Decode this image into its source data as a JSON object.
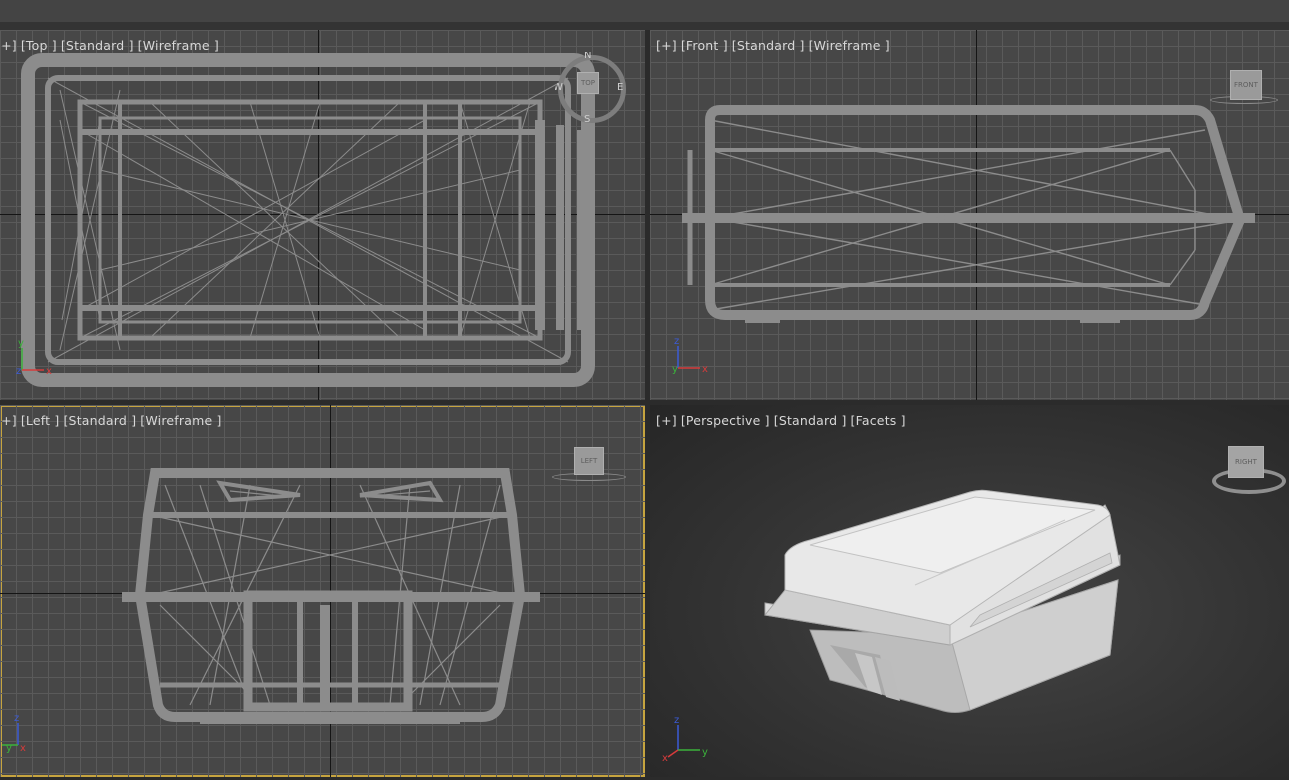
{
  "viewports": {
    "top": {
      "plus": "[+]",
      "view": "[Top ]",
      "shading": "[Standard ]",
      "mode": "[Wireframe ]"
    },
    "front": {
      "plus": "[+]",
      "view": "[Front ]",
      "shading": "[Standard ]",
      "mode": "[Wireframe ]"
    },
    "left": {
      "plus": "[+]",
      "view": "[Left ]",
      "shading": "[Standard ]",
      "mode": "[Wireframe ]"
    },
    "perspective": {
      "plus": "[+]",
      "view": "[Perspective ]",
      "shading": "[Standard ]",
      "mode": "[Facets ]"
    }
  },
  "viewcube": {
    "top_face": "TOP",
    "front_face": "FRONT",
    "left_face": "LEFT",
    "persp_face": "RIGHT",
    "compass": {
      "n": "N",
      "s": "S",
      "e": "E",
      "w": "W"
    }
  },
  "axes": {
    "x": "x",
    "y": "y",
    "z": "z"
  },
  "colors": {
    "viewport_bg": "#474747",
    "grid": "#5a5a5a",
    "wire": "#8c8c8c",
    "active_border": "#c6a43f",
    "axis_x": "#d63b3b",
    "axis_y": "#3bb23b",
    "axis_z": "#3b5bd6"
  }
}
